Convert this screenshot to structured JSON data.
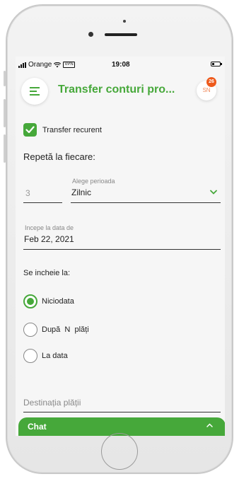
{
  "status_bar": {
    "carrier": "Orange",
    "vpn": "VPN",
    "time": "19:08"
  },
  "header": {
    "title": "Transfer conturi pro...",
    "avatar_initials": "SN",
    "notification_count": "26"
  },
  "form": {
    "recurrent_label": "Transfer recurent",
    "recurrent_checked": true,
    "repeat_label": "Repetă la fiecare:",
    "repeat_count": "3",
    "period_label": "Alege perioada",
    "period_value": "Zilnic",
    "start_label": "Incepe la data de",
    "start_value": "Feb 22, 2021",
    "ends_label": "Se incheie la:",
    "end_options": [
      {
        "label": "Niciodata",
        "selected": true
      },
      {
        "label": "După  N  plăți",
        "selected": false
      },
      {
        "label": "La data",
        "selected": false
      }
    ],
    "destination_placeholder": "Destinația plății"
  },
  "chat": {
    "label": "Chat"
  },
  "colors": {
    "accent": "#46a83a",
    "badge": "#ee5a1c"
  },
  "icons": [
    "menu-icon",
    "checkmark-icon",
    "chevron-down-icon",
    "chevron-up-icon",
    "wifi-icon",
    "battery-icon"
  ]
}
